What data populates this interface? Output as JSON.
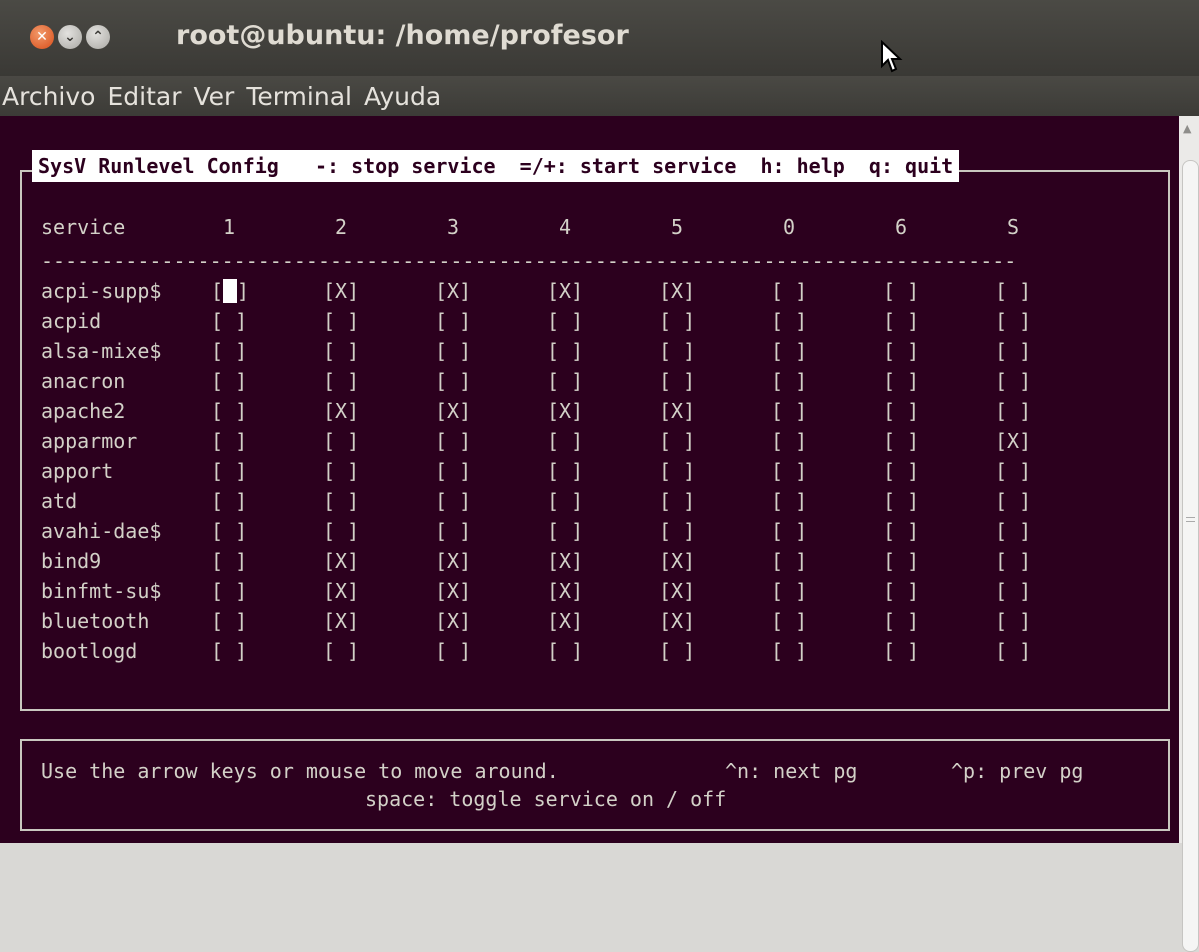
{
  "window": {
    "title": "root@ubuntu: /home/profesor",
    "buttons": [
      "close",
      "minimize",
      "maximize"
    ]
  },
  "menubar": {
    "items": [
      "Archivo",
      "Editar",
      "Ver",
      "Terminal",
      "Ayuda"
    ]
  },
  "header": {
    "app": "SysV Runlevel Config",
    "hint_stop": "-: stop service",
    "hint_start": "=/+: start service",
    "hint_help": "h: help",
    "hint_quit": "q: quit"
  },
  "table": {
    "columns": [
      "service",
      "1",
      "2",
      "3",
      "4",
      "5",
      "0",
      "6",
      "S"
    ],
    "divider": "---------------------------------------------------------------------------------",
    "selected": {
      "row": 0,
      "col": 0
    },
    "rows": [
      {
        "service": "acpi-supp$",
        "levels": [
          "[ ]",
          "[X]",
          "[X]",
          "[X]",
          "[X]",
          "[ ]",
          "[ ]",
          "[ ]"
        ]
      },
      {
        "service": "acpid",
        "levels": [
          "[ ]",
          "[ ]",
          "[ ]",
          "[ ]",
          "[ ]",
          "[ ]",
          "[ ]",
          "[ ]"
        ]
      },
      {
        "service": "alsa-mixe$",
        "levels": [
          "[ ]",
          "[ ]",
          "[ ]",
          "[ ]",
          "[ ]",
          "[ ]",
          "[ ]",
          "[ ]"
        ]
      },
      {
        "service": "anacron",
        "levels": [
          "[ ]",
          "[ ]",
          "[ ]",
          "[ ]",
          "[ ]",
          "[ ]",
          "[ ]",
          "[ ]"
        ]
      },
      {
        "service": "apache2",
        "levels": [
          "[ ]",
          "[X]",
          "[X]",
          "[X]",
          "[X]",
          "[ ]",
          "[ ]",
          "[ ]"
        ]
      },
      {
        "service": "apparmor",
        "levels": [
          "[ ]",
          "[ ]",
          "[ ]",
          "[ ]",
          "[ ]",
          "[ ]",
          "[ ]",
          "[X]"
        ]
      },
      {
        "service": "apport",
        "levels": [
          "[ ]",
          "[ ]",
          "[ ]",
          "[ ]",
          "[ ]",
          "[ ]",
          "[ ]",
          "[ ]"
        ]
      },
      {
        "service": "atd",
        "levels": [
          "[ ]",
          "[ ]",
          "[ ]",
          "[ ]",
          "[ ]",
          "[ ]",
          "[ ]",
          "[ ]"
        ]
      },
      {
        "service": "avahi-dae$",
        "levels": [
          "[ ]",
          "[ ]",
          "[ ]",
          "[ ]",
          "[ ]",
          "[ ]",
          "[ ]",
          "[ ]"
        ]
      },
      {
        "service": "bind9",
        "levels": [
          "[ ]",
          "[X]",
          "[X]",
          "[X]",
          "[X]",
          "[ ]",
          "[ ]",
          "[ ]"
        ]
      },
      {
        "service": "binfmt-su$",
        "levels": [
          "[ ]",
          "[X]",
          "[X]",
          "[X]",
          "[X]",
          "[ ]",
          "[ ]",
          "[ ]"
        ]
      },
      {
        "service": "bluetooth",
        "levels": [
          "[ ]",
          "[X]",
          "[X]",
          "[X]",
          "[X]",
          "[ ]",
          "[ ]",
          "[ ]"
        ]
      },
      {
        "service": "bootlogd",
        "levels": [
          "[ ]",
          "[ ]",
          "[ ]",
          "[ ]",
          "[ ]",
          "[ ]",
          "[ ]",
          "[ ]"
        ]
      }
    ]
  },
  "footer": {
    "line1_left": "Use the arrow keys or mouse to move around.",
    "line1_next": "^n: next pg",
    "line1_prev": "^p: prev pg",
    "line2": "space: toggle service on / off"
  },
  "colors": {
    "terminal_bg": "#2c001e",
    "terminal_fg": "#d3d1c8",
    "titlebar": "#3c3b37"
  },
  "icons": [
    "close-icon",
    "minimize-icon",
    "maximize-icon",
    "mouse-pointer-icon"
  ]
}
